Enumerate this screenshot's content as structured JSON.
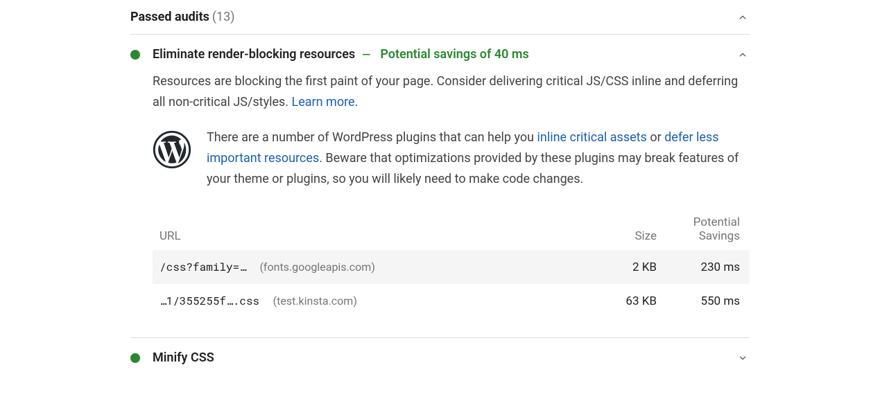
{
  "passed": {
    "label": "Passed audits",
    "count_label": "(13)"
  },
  "audit1": {
    "title": "Eliminate render-blocking resources",
    "dash": "—",
    "savings": "Potential savings of 40 ms",
    "desc_pre": "Resources are blocking the first paint of your page. Consider delivering critical JS/CSS inline and deferring all non-critical JS/styles. ",
    "desc_link": "Learn more",
    "desc_post": ".",
    "wp_pre": "There are a number of WordPress plugins that can help you ",
    "wp_link1": "inline critical assets",
    "wp_mid1": " or ",
    "wp_link2": "defer less important resources",
    "wp_post": ". Beware that optimizations provided by these plugins may break features of your theme or plugins, so you will likely need to make code changes."
  },
  "table": {
    "headers": {
      "url": "URL",
      "size": "Size",
      "savings_l1": "Potential",
      "savings_l2": "Savings"
    },
    "rows": [
      {
        "path": "/css?family=…",
        "host": "(fonts.googleapis.com)",
        "size": "2 KB",
        "savings": "230 ms"
      },
      {
        "path": "…1/355255f….css",
        "host": "(test.kinsta.com)",
        "size": "63 KB",
        "savings": "550 ms"
      }
    ]
  },
  "audit2": {
    "title": "Minify CSS"
  }
}
